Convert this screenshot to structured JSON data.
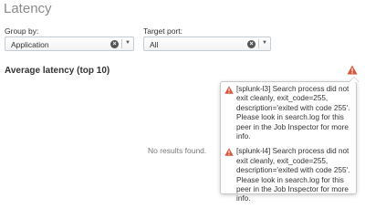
{
  "title": "Latency",
  "group_by": {
    "label": "Group by:",
    "value": "Application"
  },
  "target_port": {
    "label": "Target port:",
    "value": "All"
  },
  "panel": {
    "title": "Average latency (top 10)",
    "empty_text": "No results found."
  },
  "messages": [
    "[splunk-l3] Search process did not exit cleanly, exit_code=255, description='exited with code 255'. Please look in search.log for this peer in the Job Inspector for more info.",
    "[splunk-l4] Search process did not exit cleanly, exit_code=255, description='exited with code 255'. Please look in search.log for this peer in the Job Inspector for more info."
  ],
  "icons": {
    "clear": "clear-icon",
    "caret": "caret-down-icon",
    "warning": "warning-icon"
  },
  "colors": {
    "warning": "#d6563c"
  }
}
